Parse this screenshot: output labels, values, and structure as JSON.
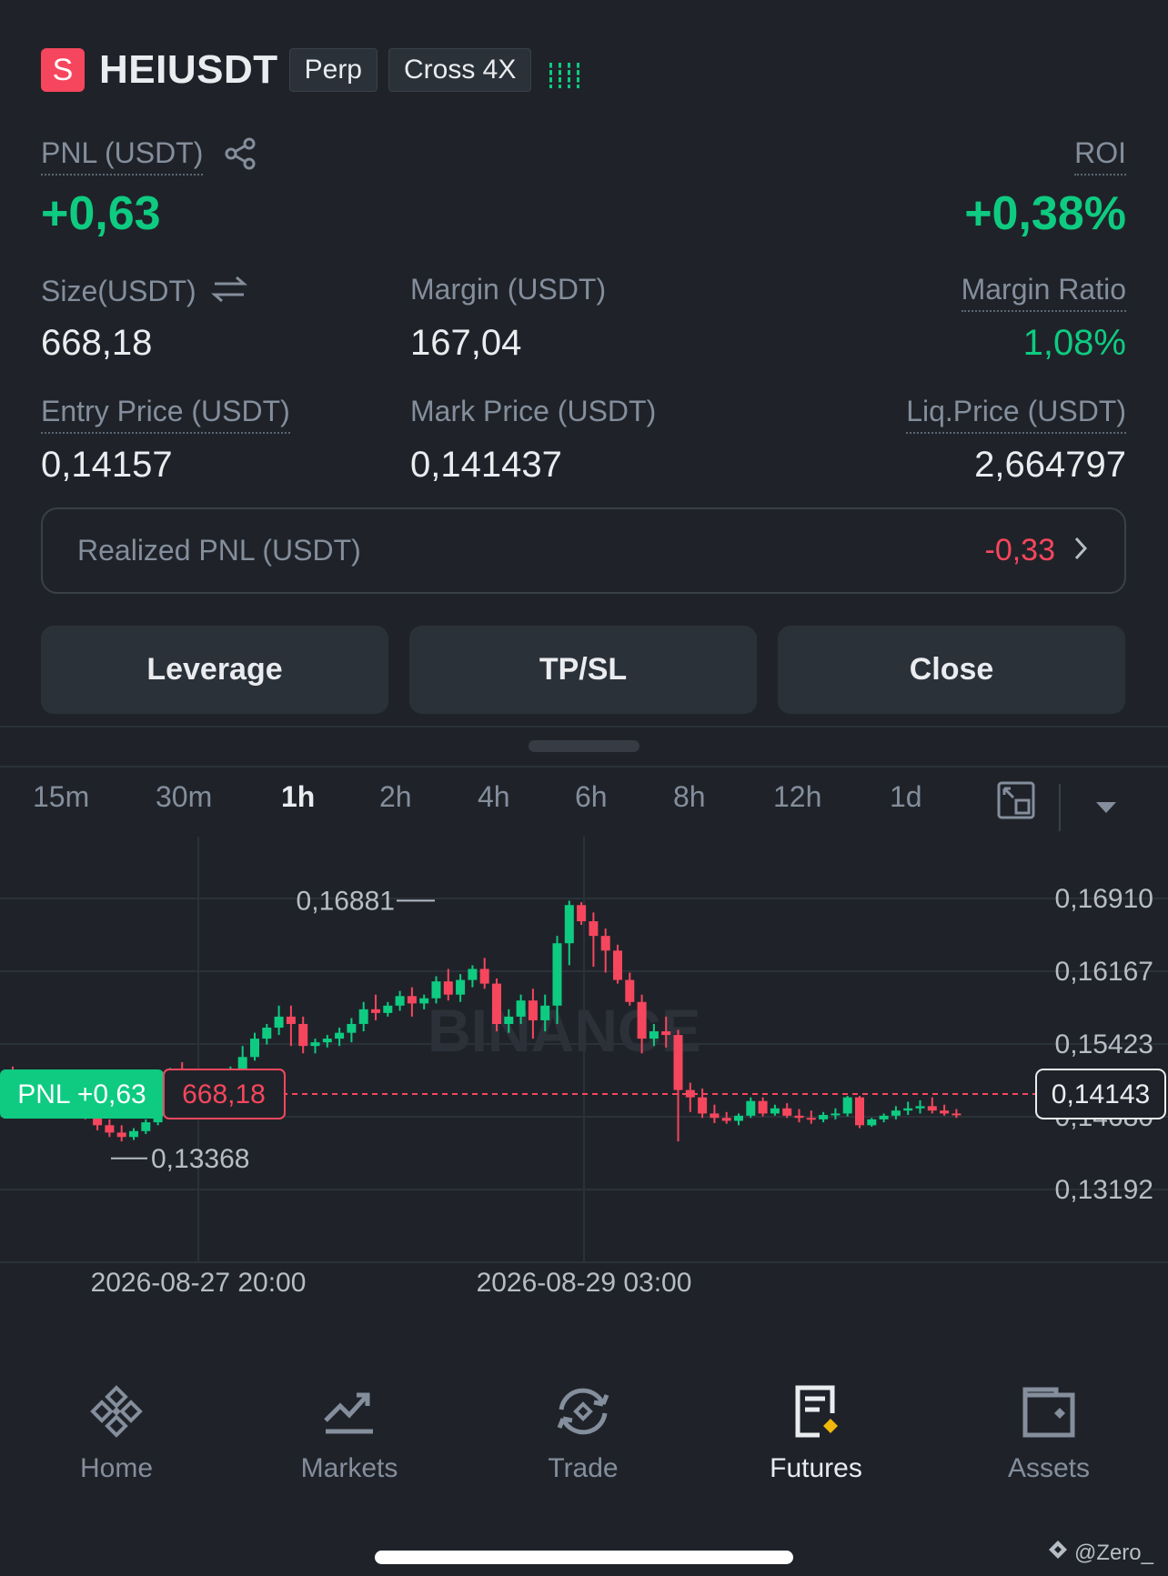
{
  "header": {
    "side_badge": "S",
    "symbol": "HEIUSDT",
    "contract_type": "Perp",
    "margin_mode": "Cross 4X"
  },
  "position": {
    "pnl_label": "PNL (USDT)",
    "pnl_value": "+0,63",
    "roi_label": "ROI",
    "roi_value": "+0,38%",
    "size_label": "Size(USDT)",
    "size_value": "668,18",
    "margin_label": "Margin (USDT)",
    "margin_value": "167,04",
    "margin_ratio_label": "Margin Ratio",
    "margin_ratio_value": "1,08%",
    "entry_label": "Entry Price (USDT)",
    "entry_value": "0,14157",
    "mark_label": "Mark Price (USDT)",
    "mark_value": "0,141437",
    "liq_label": "Liq.Price (USDT)",
    "liq_value": "2,664797",
    "realized_label": "Realized PNL (USDT)",
    "realized_value": "-0,33"
  },
  "actions": {
    "leverage": "Leverage",
    "tpsl": "TP/SL",
    "close": "Close"
  },
  "timeframes": [
    "15m",
    "30m",
    "1h",
    "2h",
    "4h",
    "6h",
    "8h",
    "12h",
    "1d"
  ],
  "active_timeframe": "1h",
  "chart_data": {
    "type": "candlestick",
    "watermark": "BINANCE",
    "y_ticks": [
      "0,16910",
      "0,16167",
      "0,15423",
      "0,14680",
      "0,13192"
    ],
    "x_ticks": [
      "2026-08-27 20:00",
      "2026-08-29 03:00"
    ],
    "ylim": [
      0.13192,
      0.1691
    ],
    "high_marker": "0,16881",
    "low_marker": "0,13368",
    "last_price": "0,14143",
    "position_tag_pnl": "PNL +0,63",
    "position_tag_size": "668,18",
    "candles": [
      [
        0.1453,
        0.1462,
        0.1446,
        0.1432
      ],
      [
        0.1446,
        0.1448,
        0.144,
        0.1435
      ],
      [
        0.144,
        0.1442,
        0.1422,
        0.1418
      ],
      [
        0.1422,
        0.1432,
        0.142,
        0.1412
      ],
      [
        0.142,
        0.1428,
        0.1414,
        0.141
      ],
      [
        0.1414,
        0.1418,
        0.1408,
        0.1402
      ],
      [
        0.1408,
        0.1412,
        0.1396,
        0.139
      ],
      [
        0.1396,
        0.1402,
        0.1382,
        0.1375
      ],
      [
        0.1382,
        0.139,
        0.1372,
        0.1366
      ],
      [
        0.1372,
        0.1382,
        0.1366,
        0.136
      ],
      [
        0.1366,
        0.1378,
        0.1374,
        0.1362
      ],
      [
        0.1374,
        0.139,
        0.1386,
        0.137
      ],
      [
        0.1386,
        0.1432,
        0.1422,
        0.1382
      ],
      [
        0.1422,
        0.146,
        0.1452,
        0.1418
      ],
      [
        0.1452,
        0.1468,
        0.1445,
        0.144
      ],
      [
        0.1445,
        0.145,
        0.143,
        0.1424
      ],
      [
        0.143,
        0.144,
        0.1438,
        0.1426
      ],
      [
        0.1438,
        0.1452,
        0.1446,
        0.1432
      ],
      [
        0.1446,
        0.1462,
        0.1458,
        0.144
      ],
      [
        0.1458,
        0.149,
        0.1475,
        0.1452
      ],
      [
        0.1475,
        0.1508,
        0.15,
        0.147
      ],
      [
        0.15,
        0.152,
        0.1515,
        0.1492
      ],
      [
        0.1515,
        0.1545,
        0.153,
        0.1505
      ],
      [
        0.153,
        0.1545,
        0.152,
        0.149
      ],
      [
        0.152,
        0.153,
        0.149,
        0.148
      ],
      [
        0.149,
        0.15,
        0.1495,
        0.148
      ],
      [
        0.1495,
        0.1505,
        0.15,
        0.1488
      ],
      [
        0.15,
        0.1515,
        0.1508,
        0.149
      ],
      [
        0.1508,
        0.1528,
        0.152,
        0.1495
      ],
      [
        0.152,
        0.155,
        0.154,
        0.151
      ],
      [
        0.154,
        0.156,
        0.1535,
        0.1525
      ],
      [
        0.1535,
        0.155,
        0.1545,
        0.153
      ],
      [
        0.1545,
        0.1565,
        0.1558,
        0.1538
      ],
      [
        0.1558,
        0.157,
        0.1548,
        0.153
      ],
      [
        0.1548,
        0.156,
        0.1555,
        0.154
      ],
      [
        0.1555,
        0.1585,
        0.1578,
        0.1548
      ],
      [
        0.1578,
        0.1595,
        0.156,
        0.1552
      ],
      [
        0.156,
        0.1588,
        0.158,
        0.155
      ],
      [
        0.158,
        0.16,
        0.1595,
        0.157
      ],
      [
        0.1595,
        0.161,
        0.1575,
        0.1568
      ],
      [
        0.1575,
        0.1582,
        0.152,
        0.151
      ],
      [
        0.152,
        0.154,
        0.153,
        0.1508
      ],
      [
        0.153,
        0.156,
        0.1552,
        0.152
      ],
      [
        0.1552,
        0.1568,
        0.1525,
        0.15
      ],
      [
        0.1525,
        0.156,
        0.1545,
        0.151
      ],
      [
        0.1545,
        0.164,
        0.163,
        0.152
      ],
      [
        0.163,
        0.1688,
        0.1682,
        0.16
      ],
      [
        0.1682,
        0.1686,
        0.166,
        0.1655
      ],
      [
        0.166,
        0.1672,
        0.164,
        0.1598
      ],
      [
        0.164,
        0.165,
        0.162,
        0.159
      ],
      [
        0.162,
        0.1628,
        0.158,
        0.1575
      ],
      [
        0.158,
        0.159,
        0.155,
        0.1545
      ],
      [
        0.155,
        0.156,
        0.15,
        0.148
      ],
      [
        0.15,
        0.152,
        0.151,
        0.149
      ],
      [
        0.151,
        0.153,
        0.1505,
        0.1488
      ],
      [
        0.1505,
        0.1512,
        0.143,
        0.136
      ],
      [
        0.143,
        0.144,
        0.142,
        0.14
      ],
      [
        0.142,
        0.1432,
        0.1398,
        0.1392
      ],
      [
        0.1398,
        0.141,
        0.1392,
        0.1385
      ],
      [
        0.1392,
        0.14,
        0.1388,
        0.1384
      ],
      [
        0.1388,
        0.1398,
        0.1395,
        0.1382
      ],
      [
        0.1395,
        0.142,
        0.1415,
        0.1392
      ],
      [
        0.1415,
        0.142,
        0.1398,
        0.1394
      ],
      [
        0.1398,
        0.141,
        0.1405,
        0.1395
      ],
      [
        0.1405,
        0.1412,
        0.1395,
        0.1392
      ],
      [
        0.1395,
        0.1404,
        0.1392,
        0.1386
      ],
      [
        0.1392,
        0.1402,
        0.139,
        0.1384
      ],
      [
        0.139,
        0.14,
        0.1396,
        0.1386
      ],
      [
        0.1396,
        0.1405,
        0.1398,
        0.139
      ],
      [
        0.1398,
        0.1422,
        0.142,
        0.1394
      ],
      [
        0.142,
        0.1422,
        0.1382,
        0.1378
      ],
      [
        0.1382,
        0.1392,
        0.139,
        0.138
      ],
      [
        0.139,
        0.1398,
        0.1395,
        0.1386
      ],
      [
        0.1395,
        0.1408,
        0.1402,
        0.139
      ],
      [
        0.1402,
        0.1414,
        0.1405,
        0.1396
      ],
      [
        0.1405,
        0.1416,
        0.1408,
        0.1398
      ],
      [
        0.1408,
        0.142,
        0.1402,
        0.1398
      ],
      [
        0.1402,
        0.141,
        0.1398,
        0.1395
      ],
      [
        0.1398,
        0.1404,
        0.1396,
        0.1392
      ]
    ]
  },
  "nav": [
    {
      "label": "Home",
      "icon": "home-icon"
    },
    {
      "label": "Markets",
      "icon": "markets-icon"
    },
    {
      "label": "Trade",
      "icon": "trade-icon"
    },
    {
      "label": "Futures",
      "icon": "futures-icon"
    },
    {
      "label": "Assets",
      "icon": "assets-icon"
    }
  ],
  "active_nav": "Futures",
  "watermark_credit": "@Zero_",
  "colors": {
    "up": "#0ecb81",
    "down": "#f6465d",
    "background": "#1f2329",
    "accent": "#f0b90b"
  }
}
